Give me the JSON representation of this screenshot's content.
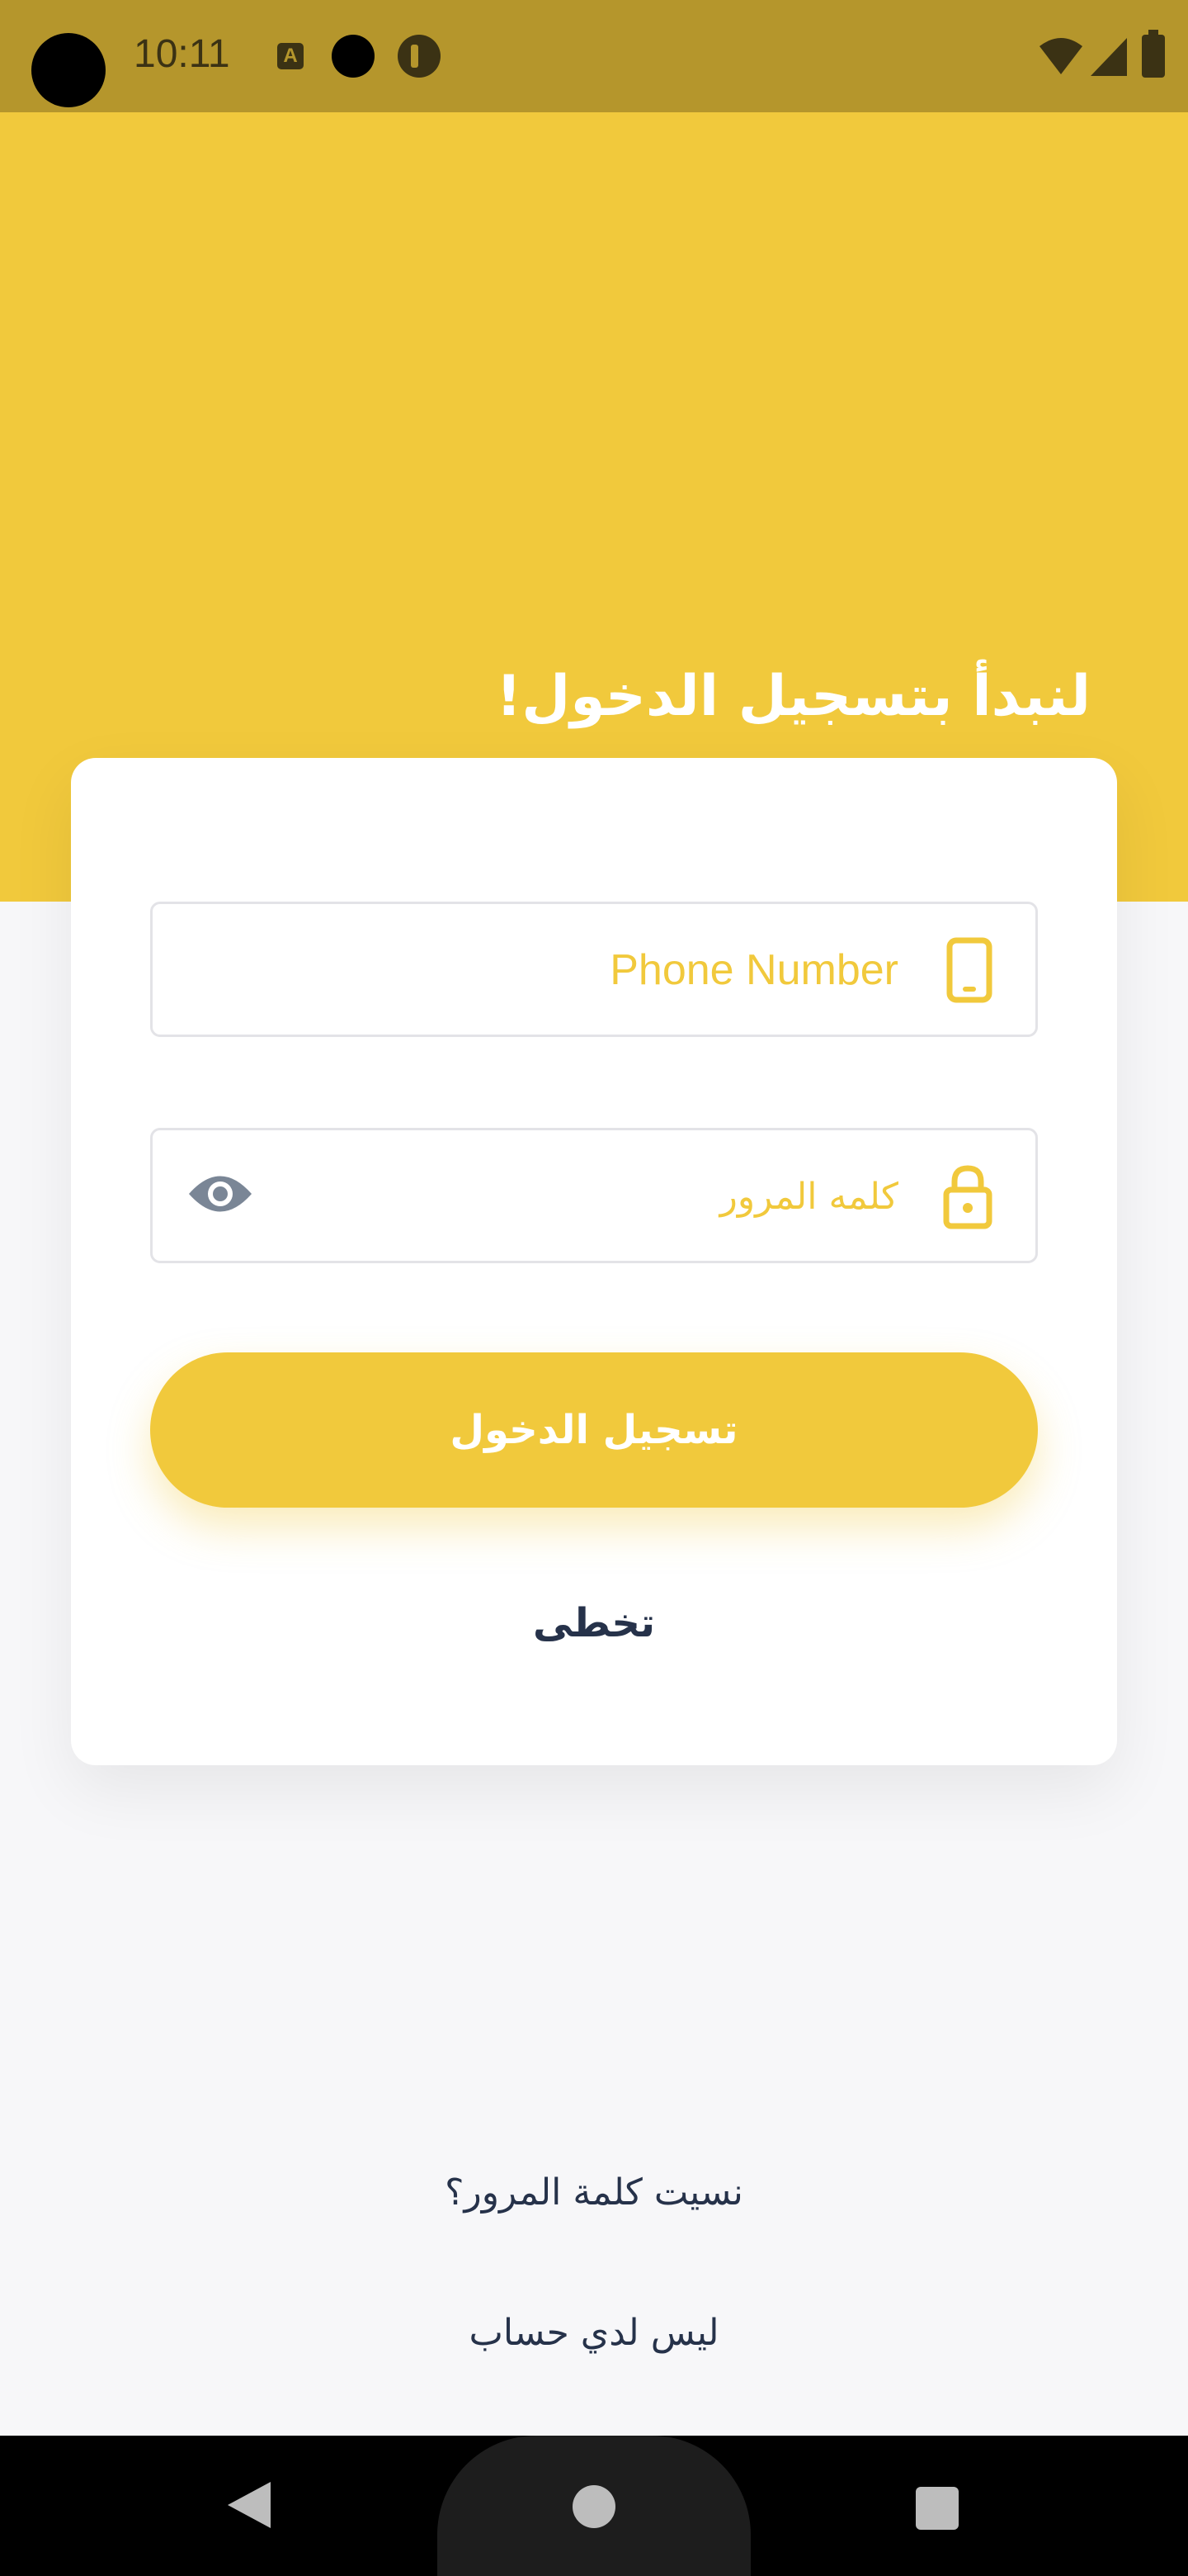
{
  "status_bar": {
    "time": "10:11",
    "notification_letter": "A"
  },
  "header": {
    "title": "لنبدأ بتسجيل الدخول!"
  },
  "form": {
    "phone_placeholder": "Phone Number",
    "password_placeholder": "كلمه المرور",
    "login_label": "تسجيل الدخول",
    "skip_label": "تخطى"
  },
  "footer": {
    "forgot_password": "نسيت كلمة المرور؟",
    "no_account": "ليس لدي حساب"
  },
  "colors": {
    "accent": "#f1c93c",
    "status_bar": "#b5962c",
    "text_dark": "#26324a",
    "icon_gray": "#7a8696",
    "background": "#f7f7f9"
  },
  "icons": [
    "wifi-icon",
    "signal-icon",
    "battery-icon",
    "phone-icon",
    "lock-icon",
    "eye-icon",
    "back-icon",
    "home-icon",
    "recents-icon"
  ]
}
